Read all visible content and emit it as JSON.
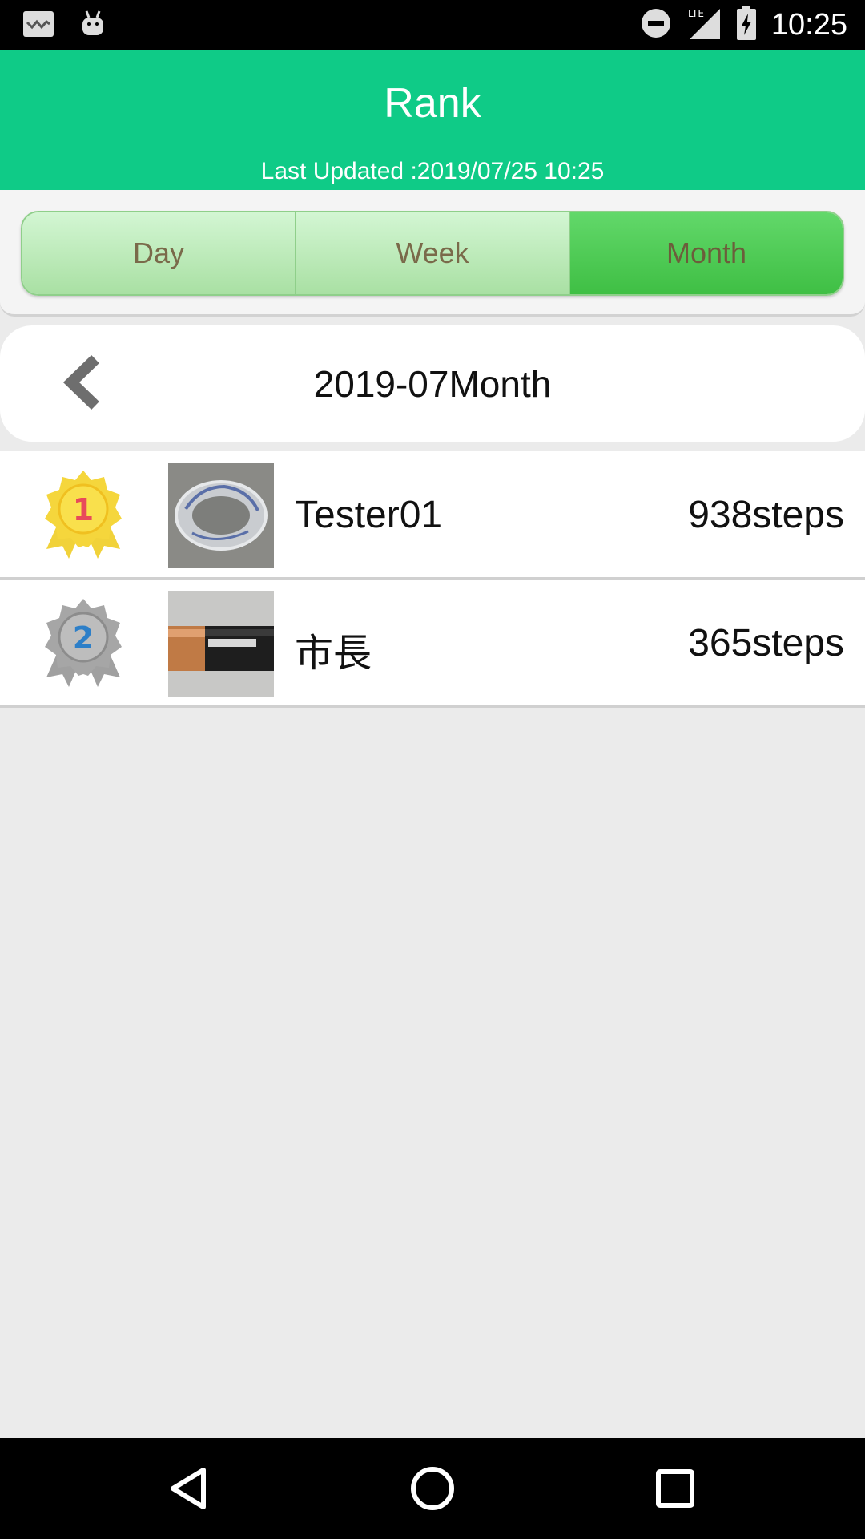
{
  "status_bar": {
    "time": "10:25",
    "icons": [
      "notification-app-icon",
      "android-icon",
      "do-not-disturb-icon",
      "lte-signal-icon",
      "battery-charging-icon"
    ]
  },
  "header": {
    "title": "Rank",
    "last_updated": "Last Updated :2019/07/25 10:25"
  },
  "period_tabs": {
    "items": [
      {
        "label": "Day",
        "active": false
      },
      {
        "label": "Week",
        "active": false
      },
      {
        "label": "Month",
        "active": true
      }
    ]
  },
  "month_nav": {
    "label": "2019-07Month",
    "prev_icon": "chevron-left-icon"
  },
  "ranking": [
    {
      "rank": "1",
      "medal": "gold-medal-icon",
      "name": "Tester01",
      "steps": "938steps",
      "photo": "tape-roll-photo"
    },
    {
      "rank": "2",
      "medal": "silver-medal-icon",
      "name": "市長",
      "steps": "365steps",
      "photo": "battery-photo"
    }
  ],
  "colors": {
    "header_bg": "#0fcb87",
    "tab_active": "#4ccb52",
    "tab_inactive": "#c5efc3",
    "gold": "#f5d43a",
    "silver": "#9a9a9a"
  },
  "nav_bar": {
    "icons": [
      "back-triangle-icon",
      "home-circle-icon",
      "recents-square-icon"
    ]
  }
}
